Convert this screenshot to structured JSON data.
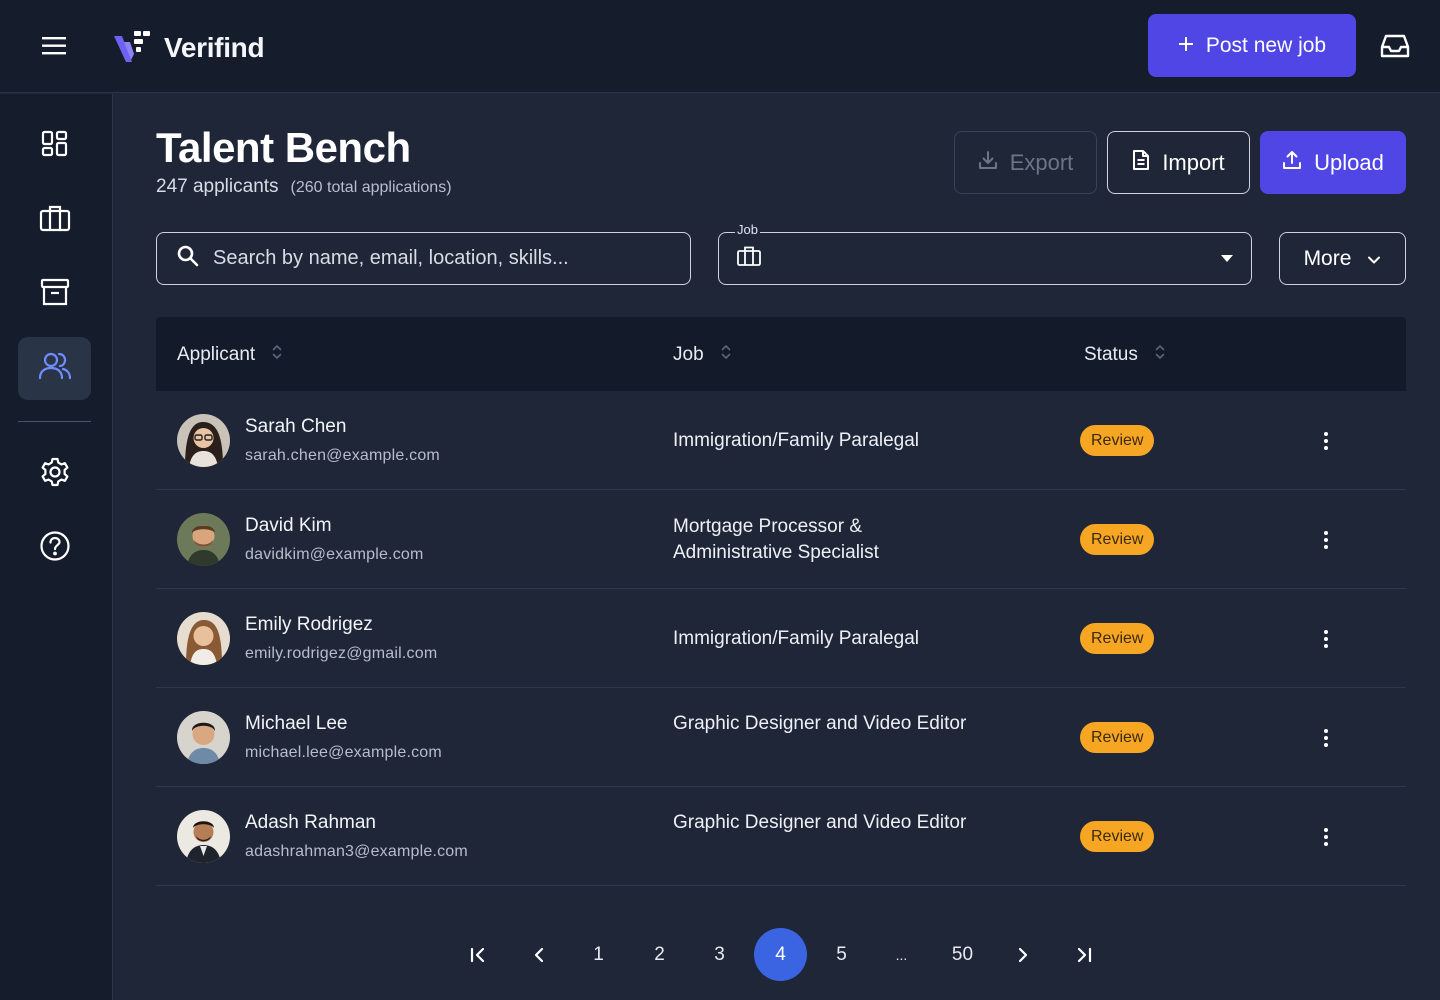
{
  "app": {
    "name": "Verifind"
  },
  "topbar": {
    "post_job_label": "Post new job",
    "post_job_icon": "plus-icon",
    "inbox_icon": "inbox-icon",
    "menu_icon": "hamburger-icon"
  },
  "sidebar": {
    "items": [
      {
        "id": "dashboard",
        "icon": "dashboard-icon",
        "active": false
      },
      {
        "id": "jobs",
        "icon": "briefcase-icon",
        "active": false
      },
      {
        "id": "archive",
        "icon": "archive-icon",
        "active": false
      },
      {
        "id": "talent",
        "icon": "users-icon",
        "active": true
      },
      {
        "id": "settings",
        "icon": "gear-icon",
        "active": false
      },
      {
        "id": "help",
        "icon": "help-icon",
        "active": false
      }
    ]
  },
  "page": {
    "title": "Talent Bench",
    "applicant_count": "247 applicants",
    "total_applications": "(260 total applications)"
  },
  "actions": {
    "export_label": "Export",
    "import_label": "Import",
    "upload_label": "Upload"
  },
  "filters": {
    "search_placeholder": "Search by name, email, location, skills...",
    "job_label": "Job",
    "job_value": "",
    "more_label": "More"
  },
  "table": {
    "columns": [
      "Applicant",
      "Job",
      "Status"
    ],
    "rows": [
      {
        "name": "Sarah Chen",
        "email": "sarah.chen@example.com",
        "job": "Immigration/Family Paralegal",
        "status": "Review"
      },
      {
        "name": "David Kim",
        "email": "davidkim@example.com",
        "job": "Mortgage Processor & Administrative Specialist",
        "status": "Review"
      },
      {
        "name": "Emily Rodrigez",
        "email": "emily.rodrigez@gmail.com",
        "job": "Immigration/Family Paralegal",
        "status": "Review"
      },
      {
        "name": "Michael Lee",
        "email": "michael.lee@example.com",
        "job": "Graphic Designer and Video Editor",
        "status": "Review"
      },
      {
        "name": "Adash Rahman",
        "email": "adashrahman3@example.com",
        "job": "Graphic Designer and Video Editor",
        "status": "Review"
      }
    ]
  },
  "pagination": {
    "pages": [
      "1",
      "2",
      "3",
      "4",
      "5",
      "...",
      "50"
    ],
    "current": "4"
  },
  "colors": {
    "accent": "#4f46e5",
    "status_review": "#f6a623",
    "page_active": "#3b64e3",
    "background": "#1e2638",
    "panel": "#151c2c"
  }
}
